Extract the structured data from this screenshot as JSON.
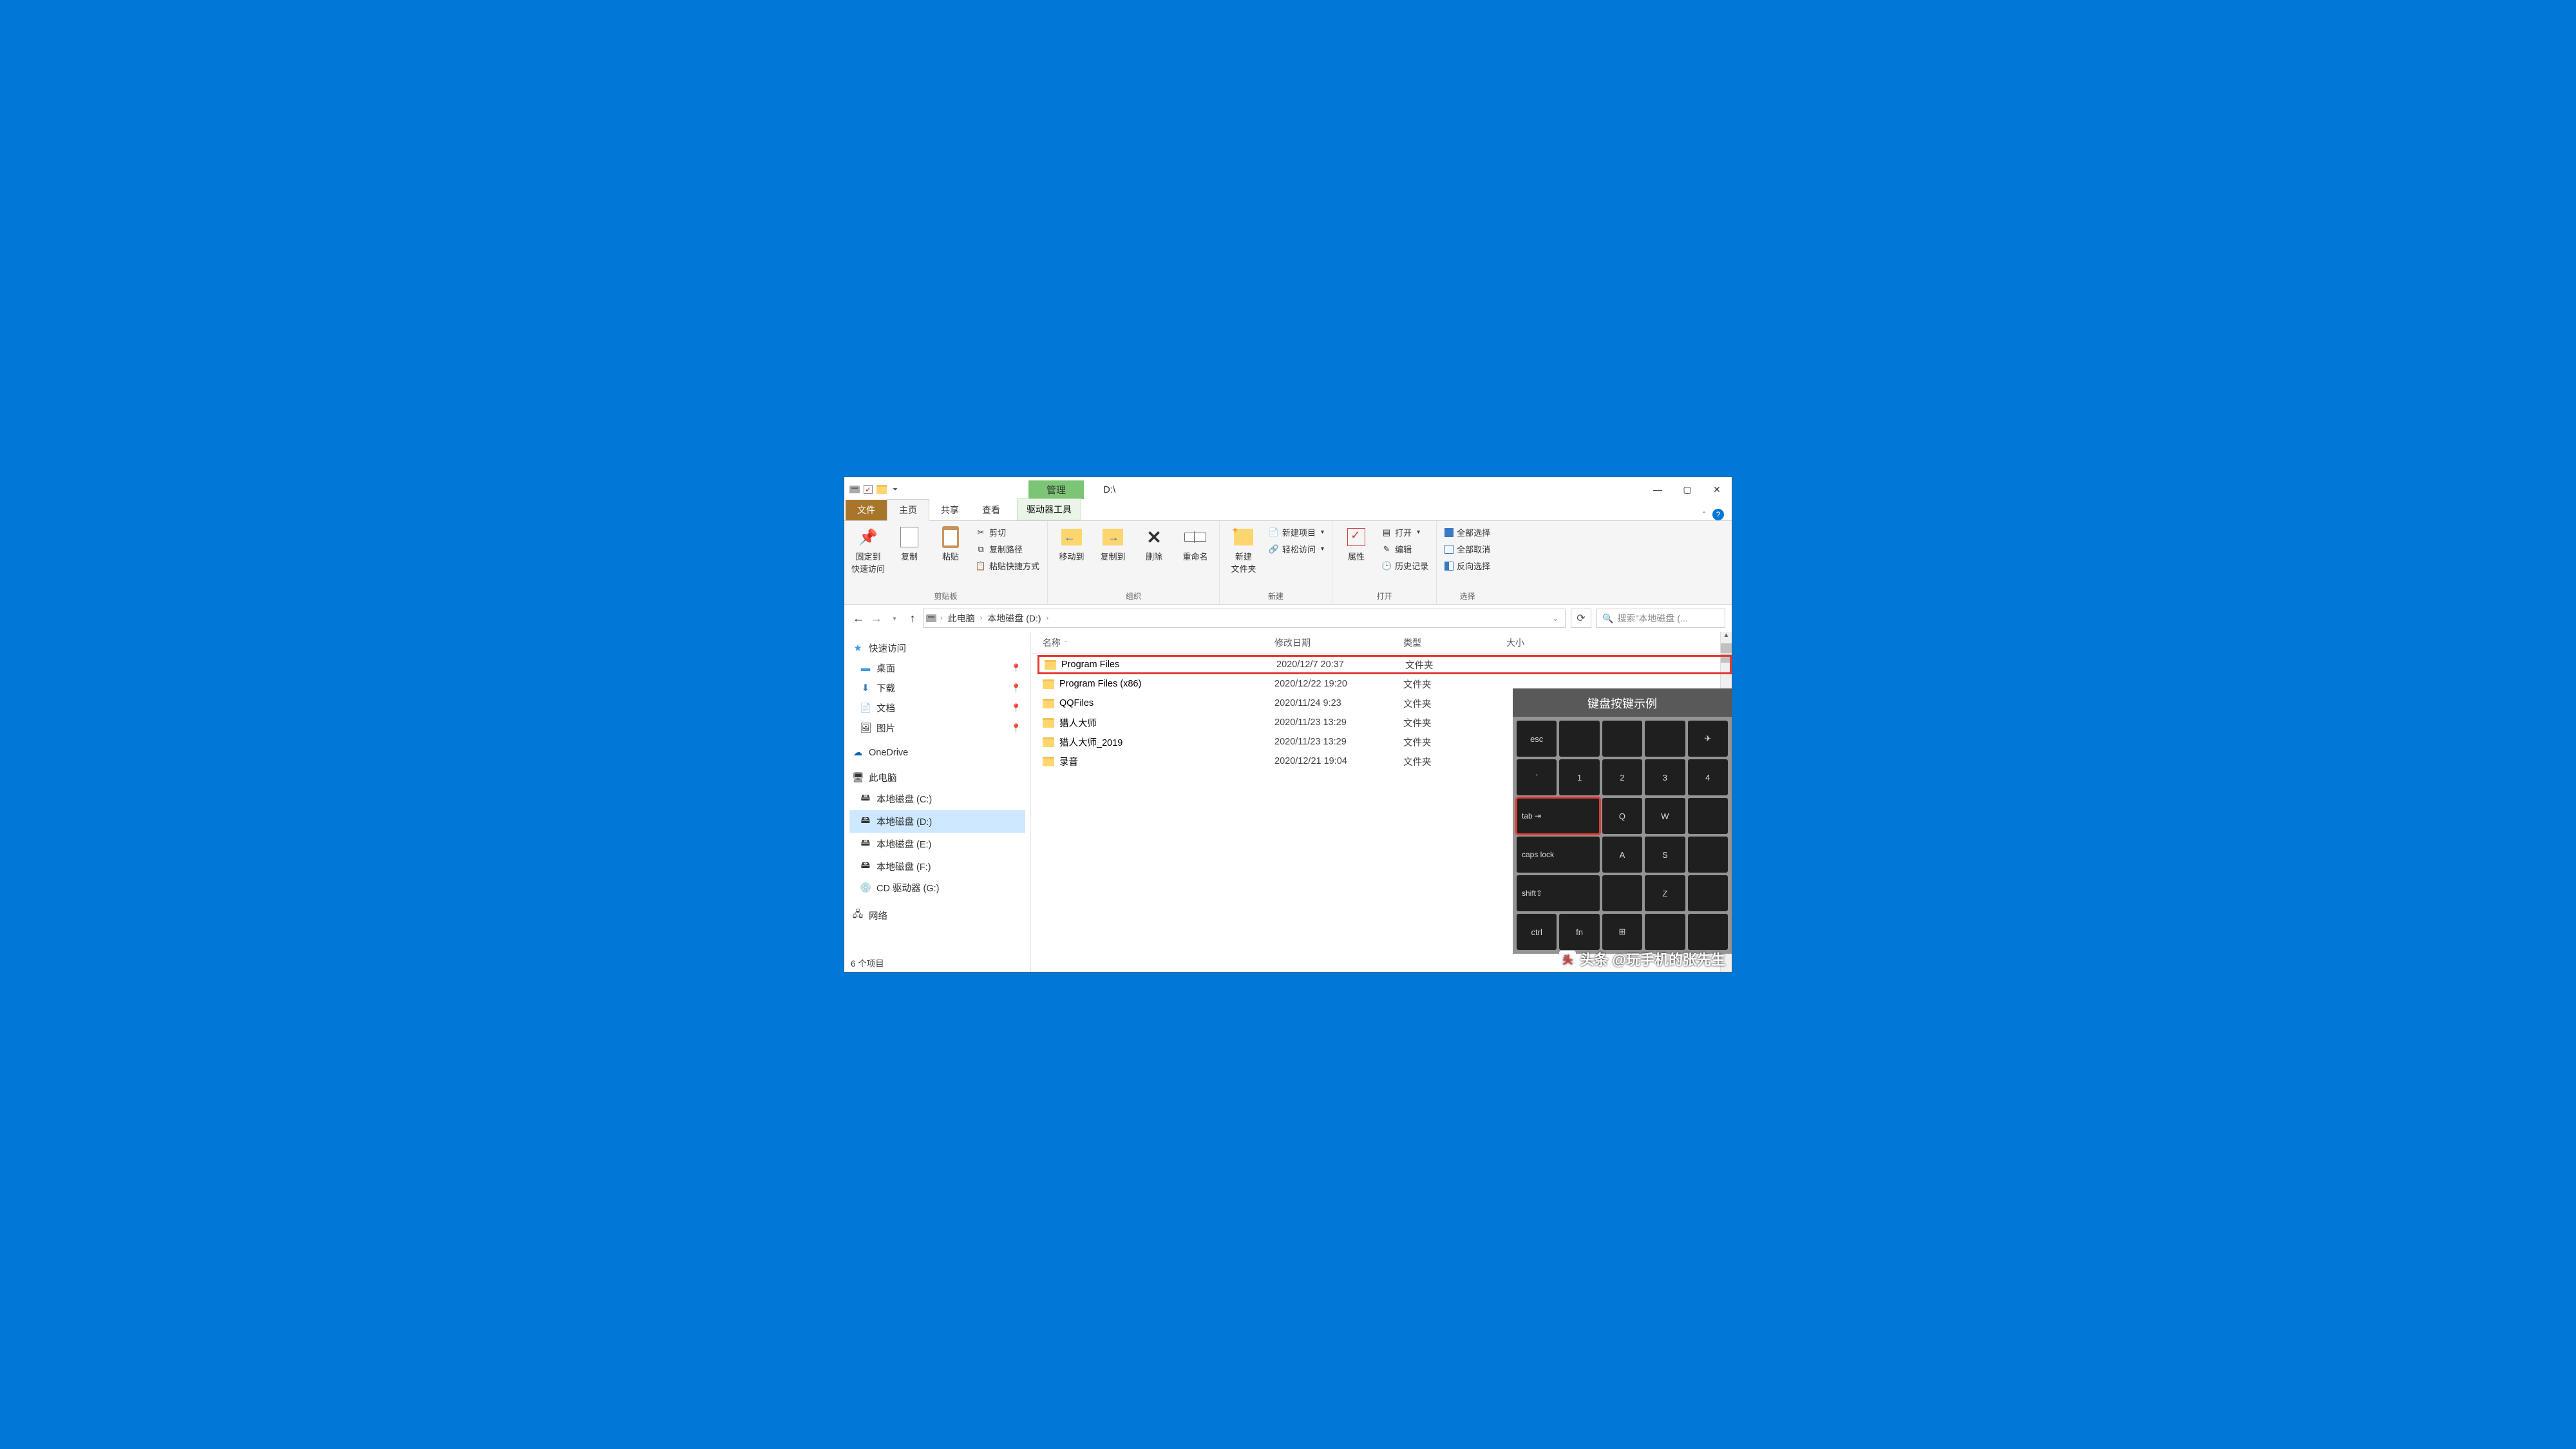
{
  "titlebar": {
    "manage": "管理",
    "path_title": "D:\\"
  },
  "tabs": {
    "file": "文件",
    "home": "主页",
    "share": "共享",
    "view": "查看",
    "drive_tools": "驱动器工具"
  },
  "ribbon": {
    "clipboard": {
      "pin": "固定到\n快速访问",
      "copy": "复制",
      "paste": "粘贴",
      "cut": "剪切",
      "copy_path": "复制路径",
      "paste_shortcut": "粘贴快捷方式",
      "group": "剪贴板"
    },
    "organize": {
      "move_to": "移动到",
      "copy_to": "复制到",
      "delete": "删除",
      "rename": "重命名",
      "group": "组织"
    },
    "new": {
      "new_folder": "新建\n文件夹",
      "new_item": "新建项目",
      "easy_access": "轻松访问",
      "group": "新建"
    },
    "open": {
      "properties": "属性",
      "open": "打开",
      "edit": "编辑",
      "history": "历史记录",
      "group": "打开"
    },
    "select": {
      "select_all": "全部选择",
      "select_none": "全部取消",
      "invert": "反向选择",
      "group": "选择"
    }
  },
  "breadcrumbs": {
    "this_pc": "此电脑",
    "drive": "本地磁盘 (D:)"
  },
  "search_placeholder": "搜索\"本地磁盘 (...",
  "sidebar": {
    "quick_access": "快速访问",
    "desktop": "桌面",
    "downloads": "下载",
    "documents": "文档",
    "pictures": "图片",
    "onedrive": "OneDrive",
    "this_pc": "此电脑",
    "drive_c": "本地磁盘 (C:)",
    "drive_d": "本地磁盘 (D:)",
    "drive_e": "本地磁盘 (E:)",
    "drive_f": "本地磁盘 (F:)",
    "cd_g": "CD 驱动器 (G:)",
    "network": "网络"
  },
  "columns": {
    "name": "名称",
    "date": "修改日期",
    "type": "类型",
    "size": "大小"
  },
  "files": [
    {
      "name": "Program Files",
      "date": "2020/12/7 20:37",
      "type": "文件夹",
      "hl": true
    },
    {
      "name": "Program Files (x86)",
      "date": "2020/12/22 19:20",
      "type": "文件夹"
    },
    {
      "name": "QQFiles",
      "date": "2020/11/24 9:23",
      "type": "文件夹"
    },
    {
      "name": "猎人大师",
      "date": "2020/11/23 13:29",
      "type": "文件夹"
    },
    {
      "name": "猎人大师_2019",
      "date": "2020/11/23 13:29",
      "type": "文件夹"
    },
    {
      "name": "录音",
      "date": "2020/12/21 19:04",
      "type": "文件夹"
    }
  ],
  "status": "6 个项目",
  "keyboard": {
    "title": "键盘按键示例",
    "keys": [
      "esc",
      "",
      "",
      "",
      "",
      "`",
      "1",
      "2",
      "3",
      "4",
      "tab",
      "Q",
      "W",
      "caps lock",
      "A",
      "S",
      "shift⇧",
      "Z",
      "ctrl",
      "fn",
      "⊞"
    ]
  },
  "watermark": "头条 @玩手机的张先生"
}
